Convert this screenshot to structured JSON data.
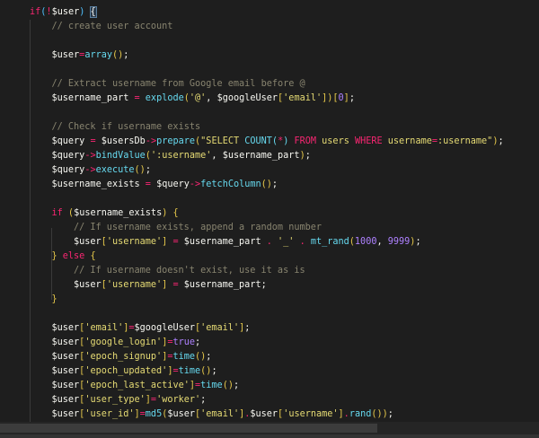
{
  "editor": {
    "lines": [
      {
        "i": 0,
        "t": [
          [
            "k",
            "if"
          ],
          [
            "b",
            "("
          ],
          [
            "o",
            "!"
          ],
          [
            "v",
            "$user"
          ],
          [
            "b",
            ")"
          ],
          [
            "t",
            " "
          ],
          [
            "hl",
            "{"
          ]
        ]
      },
      {
        "i": 1,
        "t": [
          [
            "c",
            "// create user account"
          ]
        ]
      },
      {
        "i": 1,
        "t": []
      },
      {
        "i": 1,
        "t": [
          [
            "v",
            "$user"
          ],
          [
            "o",
            "="
          ],
          [
            "f",
            "array"
          ],
          [
            "p",
            "()"
          ],
          [
            "t",
            ";"
          ]
        ]
      },
      {
        "i": 1,
        "t": []
      },
      {
        "i": 1,
        "t": [
          [
            "c",
            "// Extract username from Google email before @"
          ]
        ]
      },
      {
        "i": 1,
        "t": [
          [
            "v",
            "$username_part"
          ],
          [
            "t",
            " "
          ],
          [
            "o",
            "="
          ],
          [
            "t",
            " "
          ],
          [
            "f",
            "explode"
          ],
          [
            "p",
            "("
          ],
          [
            "s",
            "'@'"
          ],
          [
            "t",
            ", "
          ],
          [
            "v",
            "$googleUser"
          ],
          [
            "p",
            "["
          ],
          [
            "s",
            "'email'"
          ],
          [
            "p",
            "]"
          ],
          [
            "p",
            ")"
          ],
          [
            "p",
            "["
          ],
          [
            "n",
            "0"
          ],
          [
            "p",
            "]"
          ],
          [
            "t",
            ";"
          ]
        ]
      },
      {
        "i": 1,
        "t": []
      },
      {
        "i": 1,
        "t": [
          [
            "c",
            "// Check if username exists"
          ]
        ]
      },
      {
        "i": 1,
        "t": [
          [
            "v",
            "$query"
          ],
          [
            "t",
            " "
          ],
          [
            "o",
            "="
          ],
          [
            "t",
            " "
          ],
          [
            "v",
            "$usersDb"
          ],
          [
            "o",
            "->"
          ],
          [
            "f",
            "prepare"
          ],
          [
            "p",
            "("
          ],
          [
            "s",
            "\"SELECT "
          ],
          [
            "f",
            "COUNT("
          ],
          [
            "o",
            "*"
          ],
          [
            "f",
            ")"
          ],
          [
            "t",
            " "
          ],
          [
            "k",
            "FROM"
          ],
          [
            "s",
            " users "
          ],
          [
            "k",
            "WHERE"
          ],
          [
            "s",
            " username"
          ],
          [
            "o",
            "="
          ],
          [
            "s",
            ":username\""
          ],
          [
            "p",
            ")"
          ],
          [
            "t",
            ";"
          ]
        ]
      },
      {
        "i": 1,
        "t": [
          [
            "v",
            "$query"
          ],
          [
            "o",
            "->"
          ],
          [
            "f",
            "bindValue"
          ],
          [
            "p",
            "("
          ],
          [
            "s",
            "':username'"
          ],
          [
            "t",
            ", "
          ],
          [
            "v",
            "$username_part"
          ],
          [
            "p",
            ")"
          ],
          [
            "t",
            ";"
          ]
        ]
      },
      {
        "i": 1,
        "t": [
          [
            "v",
            "$query"
          ],
          [
            "o",
            "->"
          ],
          [
            "f",
            "execute"
          ],
          [
            "p",
            "()"
          ],
          [
            "t",
            ";"
          ]
        ]
      },
      {
        "i": 1,
        "t": [
          [
            "v",
            "$username_exists"
          ],
          [
            "t",
            " "
          ],
          [
            "o",
            "="
          ],
          [
            "t",
            " "
          ],
          [
            "v",
            "$query"
          ],
          [
            "o",
            "->"
          ],
          [
            "f",
            "fetchColumn"
          ],
          [
            "p",
            "()"
          ],
          [
            "t",
            ";"
          ]
        ]
      },
      {
        "i": 1,
        "t": []
      },
      {
        "i": 1,
        "t": [
          [
            "k",
            "if"
          ],
          [
            "t",
            " "
          ],
          [
            "p",
            "("
          ],
          [
            "v",
            "$username_exists"
          ],
          [
            "p",
            ")"
          ],
          [
            "t",
            " "
          ],
          [
            "p",
            "{"
          ]
        ]
      },
      {
        "i": 2,
        "t": [
          [
            "c",
            "// If username exists, append a random number"
          ]
        ]
      },
      {
        "i": 2,
        "t": [
          [
            "v",
            "$user"
          ],
          [
            "p",
            "["
          ],
          [
            "s",
            "'username'"
          ],
          [
            "p",
            "]"
          ],
          [
            "t",
            " "
          ],
          [
            "o",
            "="
          ],
          [
            "t",
            " "
          ],
          [
            "v",
            "$username_part"
          ],
          [
            "t",
            " "
          ],
          [
            "o",
            "."
          ],
          [
            "t",
            " "
          ],
          [
            "s",
            "'_'"
          ],
          [
            "t",
            " "
          ],
          [
            "o",
            "."
          ],
          [
            "t",
            " "
          ],
          [
            "f",
            "mt_rand"
          ],
          [
            "p",
            "("
          ],
          [
            "n",
            "1000"
          ],
          [
            "t",
            ", "
          ],
          [
            "n",
            "9999"
          ],
          [
            "p",
            ")"
          ],
          [
            "t",
            ";"
          ]
        ]
      },
      {
        "i": 1,
        "t": [
          [
            "p",
            "}"
          ],
          [
            "t",
            " "
          ],
          [
            "k",
            "else"
          ],
          [
            "t",
            " "
          ],
          [
            "p",
            "{"
          ]
        ]
      },
      {
        "i": 2,
        "t": [
          [
            "c",
            "// If username doesn't exist, use it as is"
          ]
        ]
      },
      {
        "i": 2,
        "t": [
          [
            "v",
            "$user"
          ],
          [
            "p",
            "["
          ],
          [
            "s",
            "'username'"
          ],
          [
            "p",
            "]"
          ],
          [
            "t",
            " "
          ],
          [
            "o",
            "="
          ],
          [
            "t",
            " "
          ],
          [
            "v",
            "$username_part"
          ],
          [
            "t",
            ";"
          ]
        ]
      },
      {
        "i": 1,
        "t": [
          [
            "p",
            "}"
          ]
        ]
      },
      {
        "i": 1,
        "t": []
      },
      {
        "i": 1,
        "t": [
          [
            "v",
            "$user"
          ],
          [
            "p",
            "["
          ],
          [
            "s",
            "'email'"
          ],
          [
            "p",
            "]"
          ],
          [
            "o",
            "="
          ],
          [
            "v",
            "$googleUser"
          ],
          [
            "p",
            "["
          ],
          [
            "s",
            "'email'"
          ],
          [
            "p",
            "]"
          ],
          [
            "t",
            ";"
          ]
        ]
      },
      {
        "i": 1,
        "t": [
          [
            "v",
            "$user"
          ],
          [
            "p",
            "["
          ],
          [
            "s",
            "'google_login'"
          ],
          [
            "p",
            "]"
          ],
          [
            "o",
            "="
          ],
          [
            "n",
            "true"
          ],
          [
            "t",
            ";"
          ]
        ]
      },
      {
        "i": 1,
        "t": [
          [
            "v",
            "$user"
          ],
          [
            "p",
            "["
          ],
          [
            "s",
            "'epoch_signup'"
          ],
          [
            "p",
            "]"
          ],
          [
            "o",
            "="
          ],
          [
            "f",
            "time"
          ],
          [
            "p",
            "()"
          ],
          [
            "t",
            ";"
          ]
        ]
      },
      {
        "i": 1,
        "t": [
          [
            "v",
            "$user"
          ],
          [
            "p",
            "["
          ],
          [
            "s",
            "'epoch_updated'"
          ],
          [
            "p",
            "]"
          ],
          [
            "o",
            "="
          ],
          [
            "f",
            "time"
          ],
          [
            "p",
            "()"
          ],
          [
            "t",
            ";"
          ]
        ]
      },
      {
        "i": 1,
        "t": [
          [
            "v",
            "$user"
          ],
          [
            "p",
            "["
          ],
          [
            "s",
            "'epoch_last_active'"
          ],
          [
            "p",
            "]"
          ],
          [
            "o",
            "="
          ],
          [
            "f",
            "time"
          ],
          [
            "p",
            "()"
          ],
          [
            "t",
            ";"
          ]
        ]
      },
      {
        "i": 1,
        "t": [
          [
            "v",
            "$user"
          ],
          [
            "p",
            "["
          ],
          [
            "s",
            "'user_type'"
          ],
          [
            "p",
            "]"
          ],
          [
            "o",
            "="
          ],
          [
            "s",
            "'worker'"
          ],
          [
            "t",
            ";"
          ]
        ]
      },
      {
        "i": 1,
        "t": [
          [
            "v",
            "$user"
          ],
          [
            "p",
            "["
          ],
          [
            "s",
            "'user_id'"
          ],
          [
            "p",
            "]"
          ],
          [
            "o",
            "="
          ],
          [
            "f",
            "md5"
          ],
          [
            "p",
            "("
          ],
          [
            "v",
            "$user"
          ],
          [
            "p",
            "["
          ],
          [
            "s",
            "'email'"
          ],
          [
            "p",
            "]"
          ],
          [
            "o",
            "."
          ],
          [
            "v",
            "$user"
          ],
          [
            "p",
            "["
          ],
          [
            "s",
            "'username'"
          ],
          [
            "p",
            "]"
          ],
          [
            "o",
            "."
          ],
          [
            "f",
            "rand"
          ],
          [
            "p",
            "()"
          ],
          [
            "p",
            ")"
          ],
          [
            "t",
            ";"
          ]
        ]
      }
    ]
  }
}
